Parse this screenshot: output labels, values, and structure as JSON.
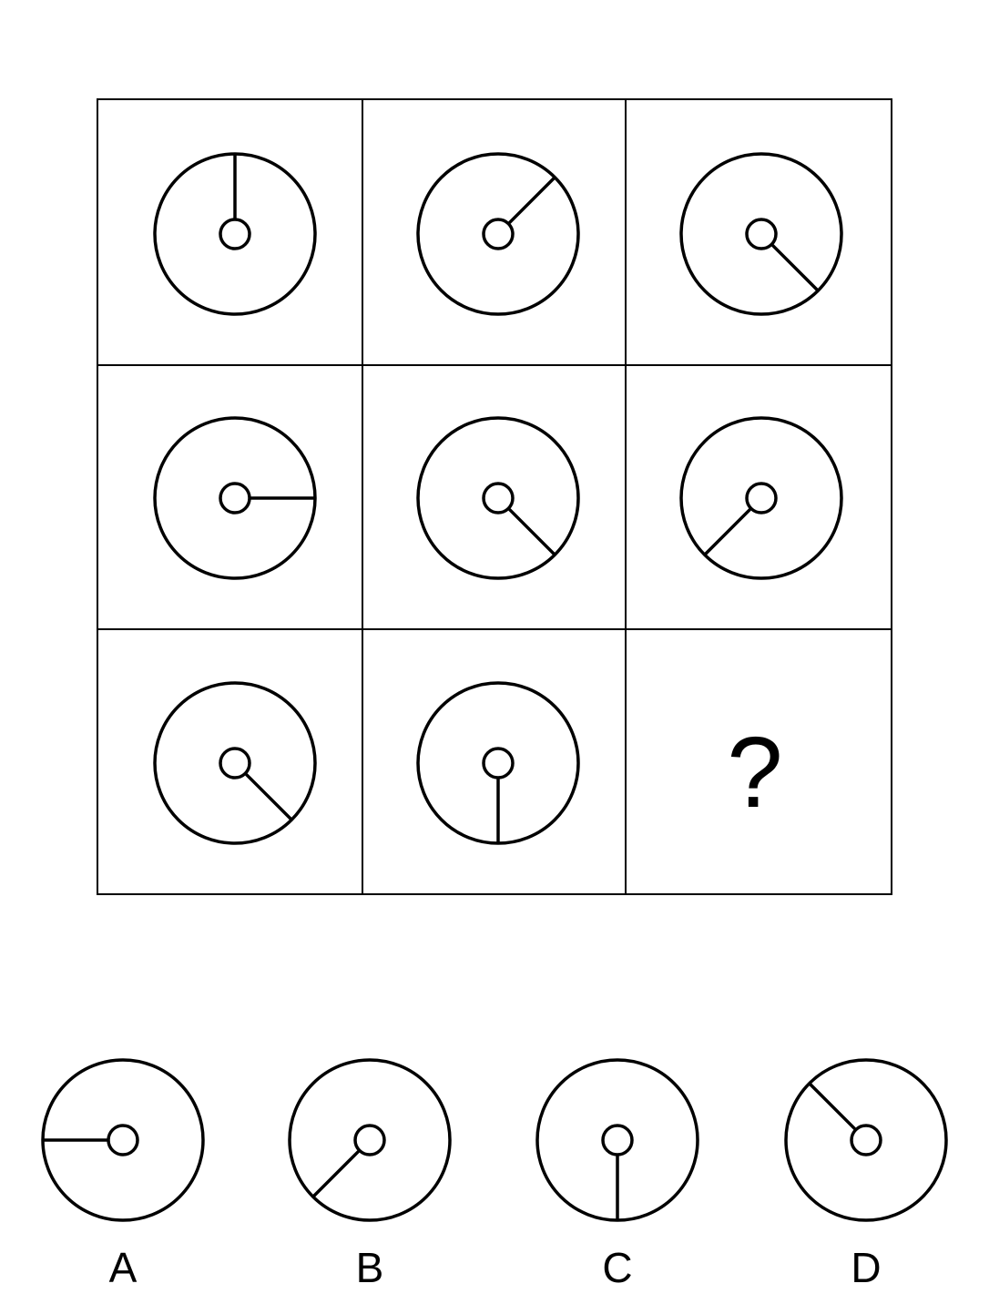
{
  "puzzle": {
    "grid": [
      {
        "cell": "r1c1",
        "hand_angle_deg": 0
      },
      {
        "cell": "r1c2",
        "hand_angle_deg": 45
      },
      {
        "cell": "r1c3",
        "hand_angle_deg": 135
      },
      {
        "cell": "r2c1",
        "hand_angle_deg": 90
      },
      {
        "cell": "r2c2",
        "hand_angle_deg": 135
      },
      {
        "cell": "r2c3",
        "hand_angle_deg": 225
      },
      {
        "cell": "r3c1",
        "hand_angle_deg": 135
      },
      {
        "cell": "r3c2",
        "hand_angle_deg": 180
      },
      {
        "cell": "r3c3",
        "missing": true
      }
    ],
    "missing_mark": "?"
  },
  "options": [
    {
      "label": "A",
      "hand_angle_deg": 270
    },
    {
      "label": "B",
      "hand_angle_deg": 225
    },
    {
      "label": "C",
      "hand_angle_deg": 180
    },
    {
      "label": "D",
      "hand_angle_deg": 315
    }
  ]
}
